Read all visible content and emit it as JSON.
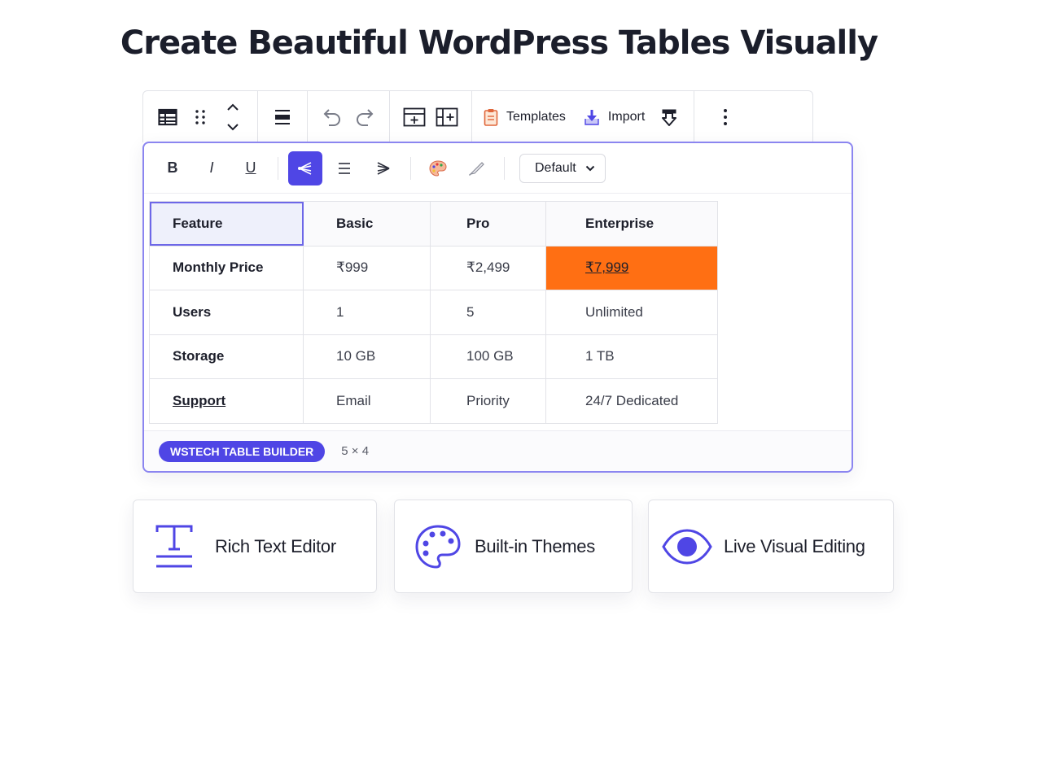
{
  "page": {
    "title": "Create Beautiful WordPress Tables Visually"
  },
  "toolbar": {
    "templates_label": "Templates",
    "import_label": "Import"
  },
  "format": {
    "bold": "B",
    "italic": "I",
    "underline": "U",
    "style_select": "Default"
  },
  "table": {
    "headers": [
      "Feature",
      "Basic",
      "Pro",
      "Enterprise"
    ],
    "rows": [
      [
        "Monthly Price",
        "₹999",
        "₹2,499",
        "₹7,999"
      ],
      [
        "Users",
        "1",
        "5",
        "Unlimited"
      ],
      [
        "Storage",
        "10 GB",
        "100 GB",
        "1 TB"
      ],
      [
        "Support",
        "Email",
        "Priority",
        "24/7 Dedicated"
      ]
    ]
  },
  "status": {
    "badge": "WSTECH TABLE BUILDER",
    "dimensions": "5 × 4"
  },
  "features": [
    {
      "label": "Rich Text Editor",
      "icon": "text-cursor-icon"
    },
    {
      "label": "Built-in Themes",
      "icon": "palette-icon"
    },
    {
      "label": "Live Visual Editing",
      "icon": "eye-icon"
    }
  ],
  "colors": {
    "accent": "#4f46e5",
    "highlight": "#ff6f13",
    "editor_border": "#8b85f0"
  }
}
